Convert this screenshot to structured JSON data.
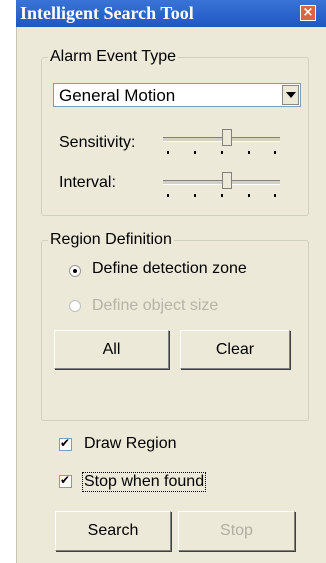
{
  "window": {
    "title": "Intelligent Search Tool",
    "close_icon": "close-icon"
  },
  "alarm_event": {
    "legend": "Alarm Event Type",
    "selected_type": "General Motion",
    "sensitivity_label": "Sensitivity:",
    "sensitivity_level": 0.55,
    "interval_label": "Interval:",
    "interval_level": 0.55
  },
  "region_definition": {
    "legend": "Region Definition",
    "options": [
      {
        "label": "Define detection zone",
        "checked": true,
        "enabled": true
      },
      {
        "label": "Define object size",
        "checked": false,
        "enabled": false
      }
    ],
    "all_label": "All",
    "clear_label": "Clear"
  },
  "options": {
    "draw_region_label": "Draw Region",
    "draw_region_checked": true,
    "stop_when_found_label": "Stop when found",
    "stop_when_found_checked": true
  },
  "actions": {
    "search_label": "Search",
    "stop_label": "Stop"
  }
}
